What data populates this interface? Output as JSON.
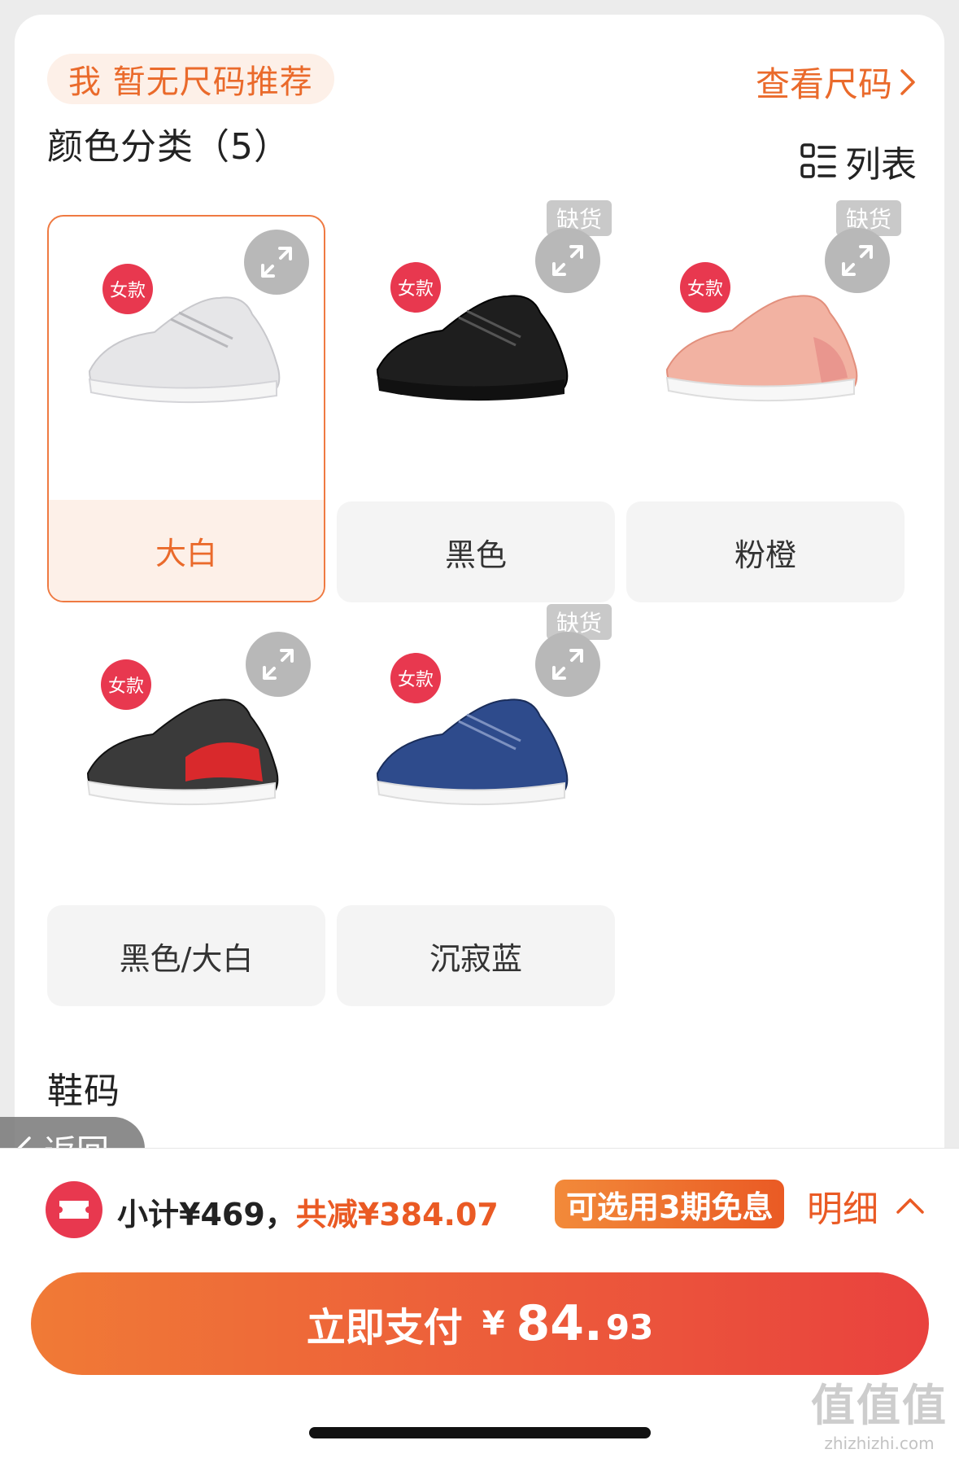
{
  "header": {
    "size_hint": "我 暂无尺码推荐",
    "size_chart_link": "查看尺码"
  },
  "color_section": {
    "title": "颜色分类（5）",
    "view_toggle_label": "列表"
  },
  "colors": [
    {
      "label": "大白",
      "women_badge": "女款",
      "out_of_stock": "",
      "selected": true
    },
    {
      "label": "黑色",
      "women_badge": "女款",
      "out_of_stock": "缺货",
      "selected": false
    },
    {
      "label": "粉橙",
      "women_badge": "女款",
      "out_of_stock": "缺货",
      "selected": false
    },
    {
      "label": "黑色/大白",
      "women_badge": "女款",
      "out_of_stock": "",
      "selected": false
    },
    {
      "label": "沉寂蓝",
      "women_badge": "女款",
      "out_of_stock": "缺货",
      "selected": false
    }
  ],
  "size_section": {
    "title": "鞋码"
  },
  "back_button": {
    "label": "返回"
  },
  "summary": {
    "subtotal": "小计¥469，",
    "discount": "共减¥384.07",
    "installment_badge": "可选用3期免息",
    "detail_link": "明细"
  },
  "pay_button": {
    "label": "立即支付",
    "currency": "¥",
    "amount_int": "84.",
    "amount_dec": "93"
  },
  "watermark": {
    "logo": "值值值",
    "url": "zhizhizhi.com"
  },
  "colors_theme": {
    "accent": "#ea6a2b",
    "badge_red": "#e8384f",
    "pay_gradient_start": "#f07a36",
    "pay_gradient_end": "#e9423e"
  }
}
